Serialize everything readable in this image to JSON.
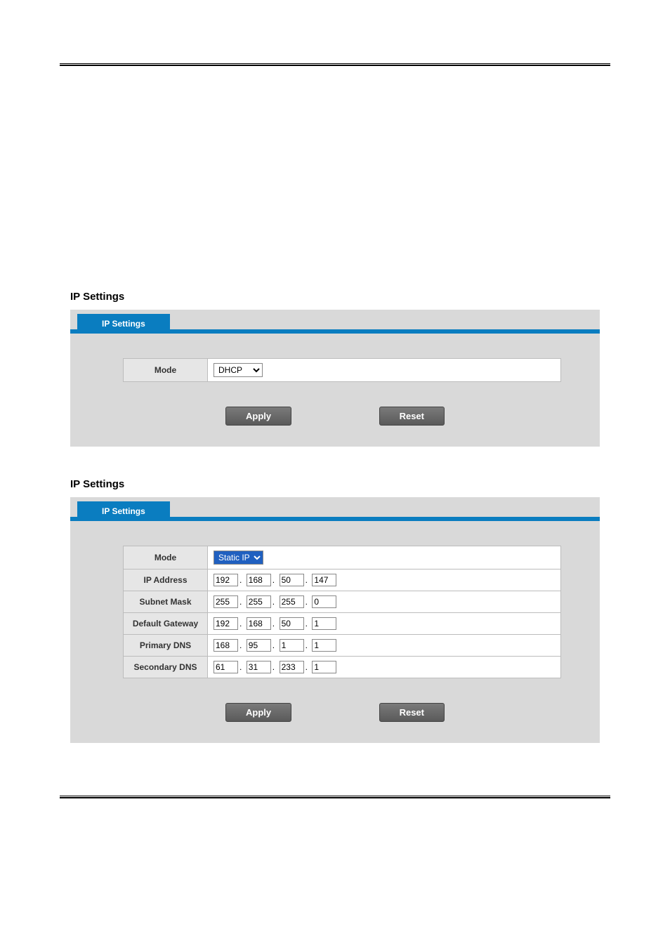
{
  "section1": {
    "heading": "IP Settings",
    "tab_label": "IP Settings",
    "form": {
      "mode": {
        "label": "Mode",
        "value": "DHCP"
      }
    },
    "buttons": {
      "apply": "Apply",
      "reset": "Reset"
    }
  },
  "section2": {
    "heading": "IP Settings",
    "tab_label": "IP Settings",
    "form": {
      "mode": {
        "label": "Mode",
        "value": "Static IP"
      },
      "ip_address": {
        "label": "IP Address",
        "octets": [
          "192",
          "168",
          "50",
          "147"
        ]
      },
      "subnet_mask": {
        "label": "Subnet Mask",
        "octets": [
          "255",
          "255",
          "255",
          "0"
        ]
      },
      "default_gateway": {
        "label": "Default Gateway",
        "octets": [
          "192",
          "168",
          "50",
          "1"
        ]
      },
      "primary_dns": {
        "label": "Primary DNS",
        "octets": [
          "168",
          "95",
          "1",
          "1"
        ]
      },
      "secondary_dns": {
        "label": "Secondary DNS",
        "octets": [
          "61",
          "31",
          "233",
          "1"
        ]
      }
    },
    "buttons": {
      "apply": "Apply",
      "reset": "Reset"
    }
  }
}
